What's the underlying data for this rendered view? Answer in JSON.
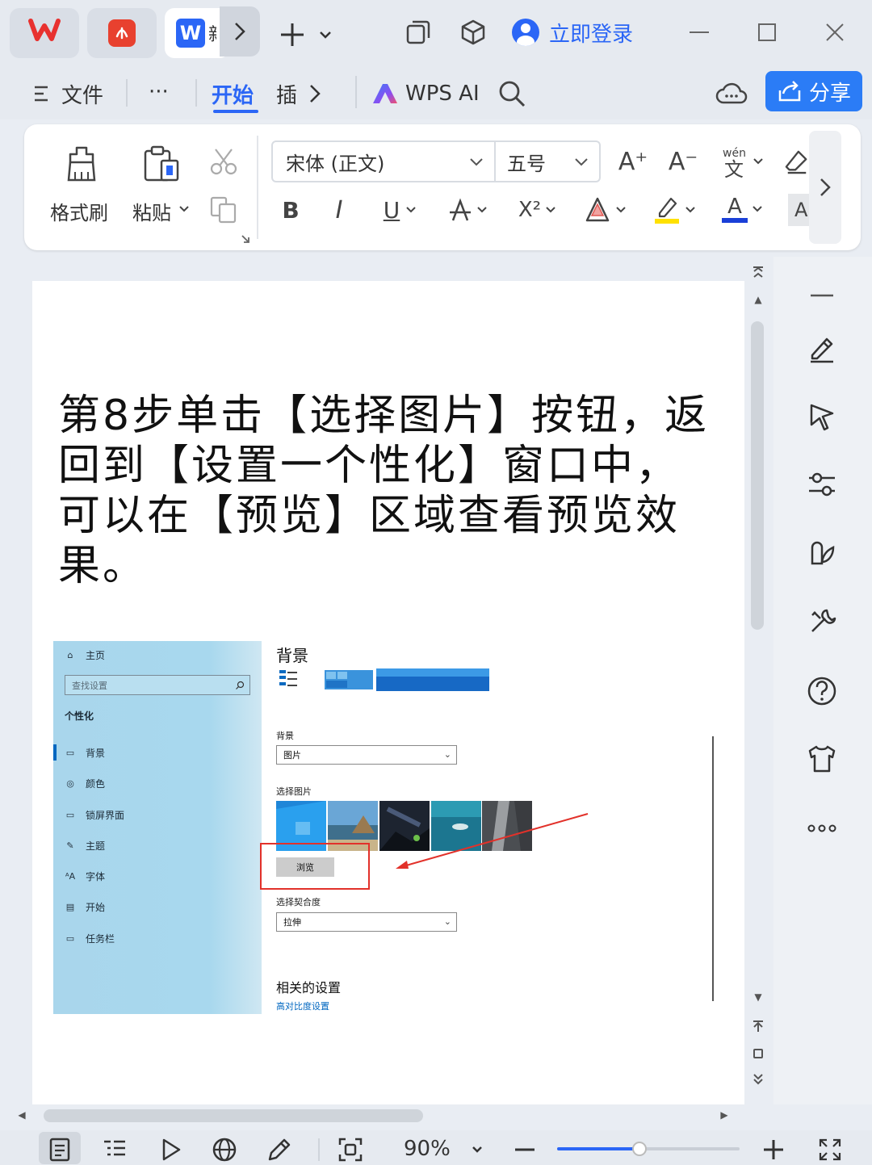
{
  "titlebar": {
    "doc_tab_text": "新",
    "login_label": "立即登录"
  },
  "menubar": {
    "file_label": "文件",
    "more_label": "···",
    "home_label": "开始",
    "insert_label": "插",
    "wps_ai_label": "WPS AI",
    "share_label": "分享"
  },
  "ribbon": {
    "format_painter_label": "格式刷",
    "paste_label": "粘贴",
    "font_name": "宋体 (正文)",
    "font_size": "五号",
    "bold_label": "B",
    "italic_label": "I",
    "underline_label": "U",
    "superscript_label": "X²",
    "grow_font_label": "A⁺",
    "shrink_font_label": "A⁻",
    "pinyin_label": "wén",
    "font_color_label": "A"
  },
  "document": {
    "heading": "第8步单击【选择图片】按钮，返回到【设置一个性化】窗口中，可以在【预览】区域查看预览效果。"
  },
  "settings_screenshot": {
    "home": "主页",
    "search_placeholder": "查找设置",
    "section": "个性化",
    "nav_items": [
      "背景",
      "颜色",
      "锁屏界面",
      "主题",
      "字体",
      "开始",
      "任务栏"
    ],
    "title": "背景",
    "background_label": "背景",
    "background_value": "图片",
    "choose_picture_label": "选择图片",
    "browse_label": "浏览",
    "fit_label": "选择契合度",
    "fit_value": "拉伸",
    "related_title": "相关的设置",
    "related_link": "高对比度设置"
  },
  "statusbar": {
    "zoom": "90%",
    "zoom_fraction": 0.45
  },
  "colors": {
    "accent": "#2b66f6",
    "wps_red": "#e8312f",
    "highlight_box": "#e2312a"
  }
}
